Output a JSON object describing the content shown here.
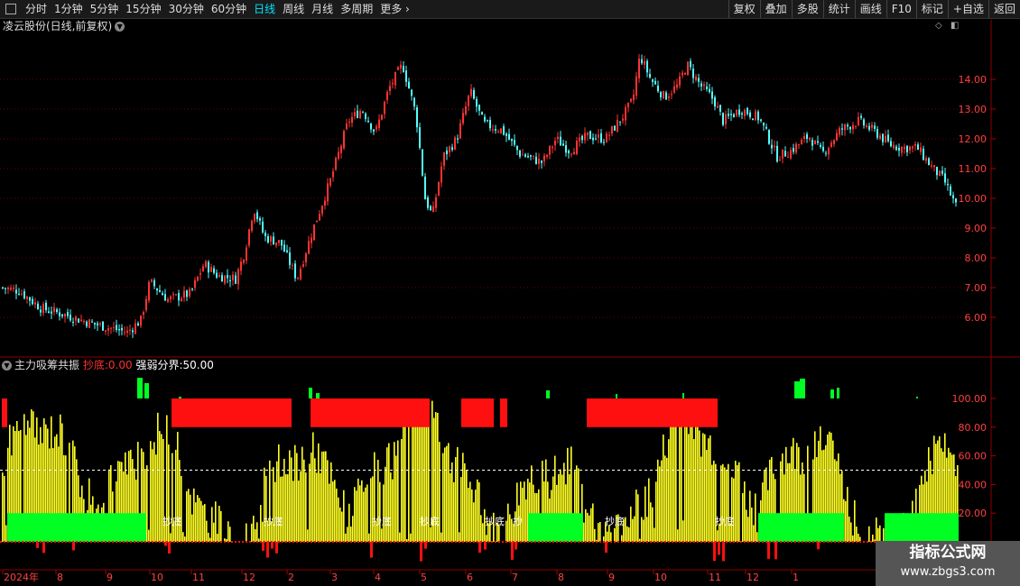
{
  "toolbar": {
    "periods": [
      "分时",
      "1分钟",
      "5分钟",
      "15分钟",
      "30分钟",
      "60分钟",
      "日线",
      "周线",
      "月线",
      "多周期",
      "更多"
    ],
    "active_period": "日线",
    "right_buttons": [
      "复权",
      "叠加",
      "多股",
      "统计",
      "画线",
      "F10",
      "标记",
      "+自选",
      "返回"
    ]
  },
  "main_panel": {
    "title": "凌云股份(日线,前复权)",
    "y_ticks": [
      "14.00",
      "13.00",
      "12.00",
      "11.00",
      "10.00",
      "9.00",
      "8.00",
      "7.00",
      "6.00"
    ],
    "up_color": "#ff3333",
    "down_color": "#54ffff"
  },
  "sub_panel": {
    "indicator_name": "主力吸筹共振",
    "label1": "抄底:",
    "value1": "0.00",
    "label2": "强弱分界:",
    "value2": "50.00",
    "y_ticks": [
      "100.00",
      "80.00",
      "60.00",
      "40.00",
      "20.00"
    ],
    "bottom_label": "抄底",
    "partial_label": "抄",
    "colors": {
      "yellow": "#ffff22",
      "red": "#ff1010",
      "green": "#00ff22",
      "white_line": "#ffffff"
    }
  },
  "x_axis": {
    "labels": [
      "2024年",
      "8",
      "9",
      "10",
      "11",
      "12",
      "2",
      "3",
      "4",
      "5",
      "6",
      "7",
      "8",
      "9",
      "10",
      "11",
      "12",
      "1"
    ]
  },
  "watermark": {
    "line1": "指标公式网",
    "line2": "www.zbgs3.com"
  }
}
